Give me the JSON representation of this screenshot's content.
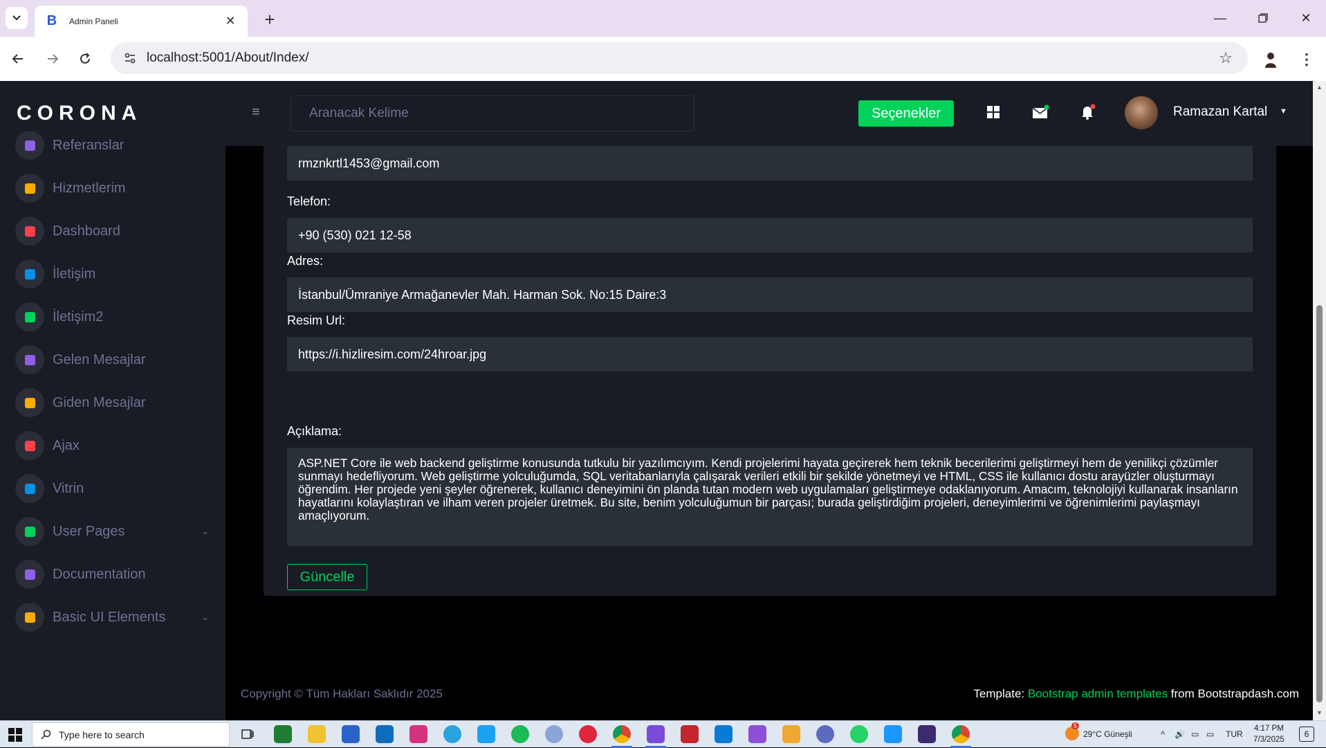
{
  "browser": {
    "tab_title": "Admin Paneli",
    "tab_favicon_letter": "B",
    "url": "localhost:5001/About/Index/"
  },
  "sidebar": {
    "brand": "CORONA",
    "items": [
      {
        "label": "Referanslar",
        "icon": "contacts-icon",
        "color": "#8f5fe8"
      },
      {
        "label": "Hizmetlerim",
        "icon": "contacts-icon",
        "color": "#ffab00"
      },
      {
        "label": "Dashboard",
        "icon": "chart-icon",
        "color": "#fc424a"
      },
      {
        "label": "İletişim",
        "icon": "contacts-icon",
        "color": "#0090e7"
      },
      {
        "label": "İletişim2",
        "icon": "contacts-icon",
        "color": "#00d25b"
      },
      {
        "label": "Gelen Mesajlar",
        "icon": "contacts-icon",
        "color": "#8f5fe8"
      },
      {
        "label": "Giden Mesajlar",
        "icon": "contacts-icon",
        "color": "#ffab00"
      },
      {
        "label": "Ajax",
        "icon": "lifebuoy-icon",
        "color": "#fc424a"
      },
      {
        "label": "Vitrin",
        "icon": "chart-icon",
        "color": "#0090e7"
      },
      {
        "label": "User Pages",
        "icon": "shield-icon",
        "color": "#00d25b"
      },
      {
        "label": "Documentation",
        "icon": "document-icon",
        "color": "#8f5fe8"
      },
      {
        "label": "Basic UI Elements",
        "icon": "laptop-icon",
        "color": "#ffab00"
      }
    ]
  },
  "topbar": {
    "search_placeholder": "Aranacak Kelime",
    "options_label": "Seçenekler",
    "user_name": "Ramazan Kartal"
  },
  "form": {
    "email_value": "rmznkrtl1453@gmail.com",
    "phone_label": "Telefon:",
    "phone_value": "+90 (530) 021 12-58",
    "address_label": "Adres:",
    "address_value": "İstanbul/Ümraniye Armağanevler Mah. Harman Sok. No:15 Daire:3",
    "image_label": "Resim Url:",
    "image_value": "https://i.hizliresim.com/24hroar.jpg",
    "description_label": "Açıklama:",
    "description_value": "ASP.NET Core ile web backend geliştirme konusunda tutkulu bir yazılımcıyım. Kendi projelerimi hayata geçirerek hem teknik becerilerimi geliştirmeyi hem de yenilikçi çözümler sunmayı hedefliyorum. Web geliştirme yolculuğumda, SQL veritabanlarıyla çalışarak verileri etkili bir şekilde yönetmeyi ve HTML, CSS ile kullanıcı dostu arayüzler oluşturmayı öğrendim. Her projede yeni şeyler öğrenerek, kullanıcı deneyimini ön planda tutan modern web uygulamaları geliştirmeye odaklanıyorum. Amacım, teknolojiyi kullanarak insanların hayatlarını kolaylaştıran ve ilham veren projeler üretmek. Bu site, benim yolculuğumun bir parçası; burada geliştirdiğim projeleri, deneyimlerimi ve öğrenimlerimi paylaşmayı amaçlıyorum.",
    "update_button": "Güncelle"
  },
  "footer": {
    "copyright": "Copyright © Tüm Hakları Saklıdır 2025",
    "template_prefix": "Template: ",
    "template_link": "Bootstrap admin templates",
    "template_suffix": " from Bootstrapdash.com"
  },
  "taskbar": {
    "search_placeholder": "Type here to search",
    "weather_badge": "5",
    "weather": "29°C  Güneşli",
    "language": "TUR",
    "time": "4:17 PM",
    "date": "7/3/2025",
    "notification_count": "6"
  },
  "colors": {
    "accent": "#00d25b",
    "sidebar_bg": "#191c24",
    "input_bg": "#2a3038"
  }
}
